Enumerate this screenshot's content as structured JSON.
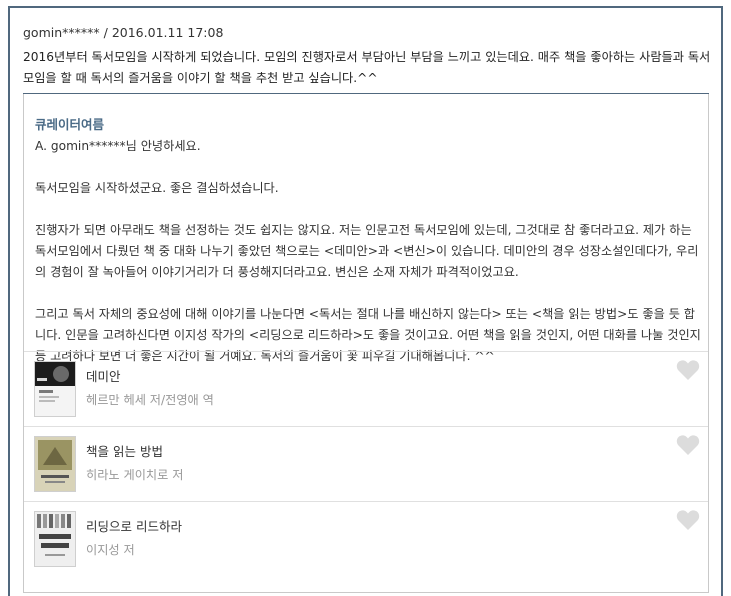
{
  "question": {
    "author": "gomin******",
    "separator": " / ",
    "datetime": "2016.01.11 17:08",
    "text": "2016년부터 독서모임을 시작하게 되었습니다. 모임의 진행자로서 부담아닌 부담을 느끼고 있는데요. 매주 책을 좋아하는 사람들과 독서모임을 할 때 독서의 즐거움을 이야기 할 책을 추천 받고 싶습니다.^^"
  },
  "answer": {
    "curator": "큐레이터여름",
    "greeting": "A. gomin******님 안녕하세요.",
    "para1": "독서모임을 시작하셨군요. 좋은 결심하셨습니다.",
    "para2": "진행자가 되면 아무래도 책을 선정하는 것도 쉽지는 않지요. 저는 인문고전 독서모임에 있는데, 그것대로 참 좋더라고요. 제가 하는 독서모임에서 다뤘던 책 중 대화 나누기 좋았던 책으로는 <데미안>과 <변신>이 있습니다. 데미안의 경우 성장소설인데다가, 우리의 경험이 잘 녹아들어 이야기거리가 더 풍성해지더라고요. 변신은 소재 자체가 파격적이었고요.",
    "para3": "그리고 독서 자체의 중요성에 대해 이야기를 나눈다면 <독서는 절대 나를 배신하지 않는다> 또는 <책을 읽는 방법>도 좋을 듯 합니다. 인문을 고려하신다면 이지성 작가의 <리딩으로 리드하라>도 좋을 것이고요. 어떤 책을 읽을 것인지, 어떤 대화를 나눌 것인지 등 고려하다 보면 더 좋은 시간이 될 거예요. 독서의 즐거움이 꽃 피우길 기대해봅니다. ^^"
  },
  "books": [
    {
      "title": "데미안",
      "author": "헤르만 헤세 저/전영애 역"
    },
    {
      "title": "책을 읽는 방법",
      "author": "히라노 게이치로 저"
    },
    {
      "title": "리딩으로 리드하라",
      "author": "이지성 저"
    }
  ],
  "colors": {
    "accent_border": "#50687e",
    "curator_name": "#4a6a86",
    "heart": "#dcdcdc",
    "muted_text": "#999999"
  },
  "icons": {
    "heart": "heart-icon"
  }
}
